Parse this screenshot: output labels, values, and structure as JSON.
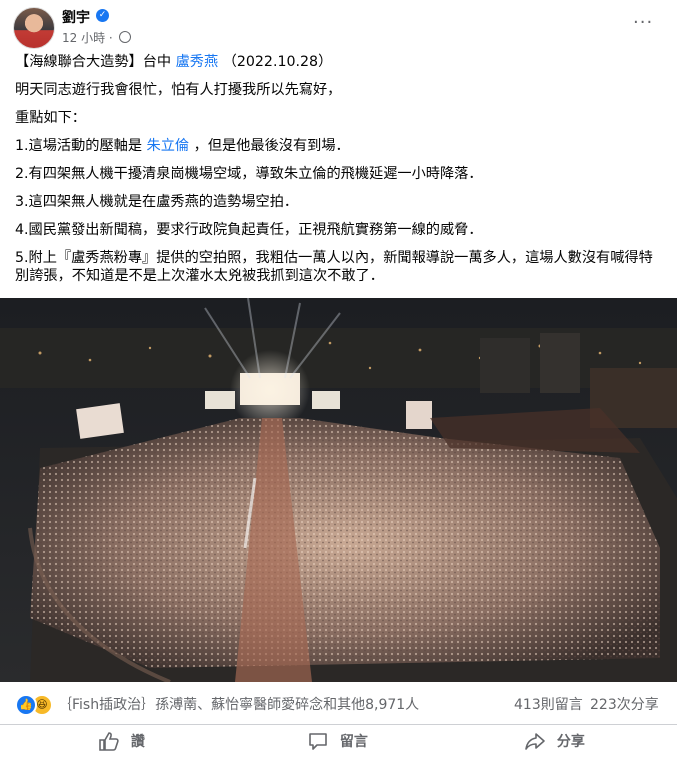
{
  "post": {
    "author": "劉宇",
    "time": "12 小時",
    "separator": "·",
    "more": "···",
    "text": {
      "line1_prefix": "【海線聯合大造勢】台中 ",
      "line1_link": "盧秀燕",
      "line1_suffix": " （2022.10.28）",
      "line2": "明天同志遊行我會很忙，怕有人打擾我所以先寫好，",
      "line3": "重點如下：",
      "item1_prefix": "1.這場活動的壓軸是 ",
      "item1_link": "朱立倫",
      "item1_suffix": " ，但是他最後沒有到場．",
      "item2": "2.有四架無人機干擾清泉崗機場空域，導致朱立倫的飛機延遲一小時降落．",
      "item3": "3.這四架無人機就是在盧秀燕的造勢場空拍．",
      "item4": "4.國民黨發出新聞稿，要求行政院負起責任，正視飛航實務第一線的威脅．",
      "item5": "5.附上『盧秀燕粉專』提供的空拍照，我粗估一萬人以內，新聞報導說一萬多人，這場人數沒有喊得特別誇張，不知道是不是上次灌水太兇被我抓到這次不敢了．"
    }
  },
  "reactions": {
    "names": "｛Fish插政治｝孫溥萳、蘇怡寧醫師愛碎念和其他8,971人",
    "comments": "413則留言",
    "shares": "223次分享"
  },
  "actions": {
    "like": "讚",
    "comment": "留言",
    "share": "分享"
  },
  "colors": {
    "accent": "#1877f2",
    "secondary_text": "#65676b"
  }
}
